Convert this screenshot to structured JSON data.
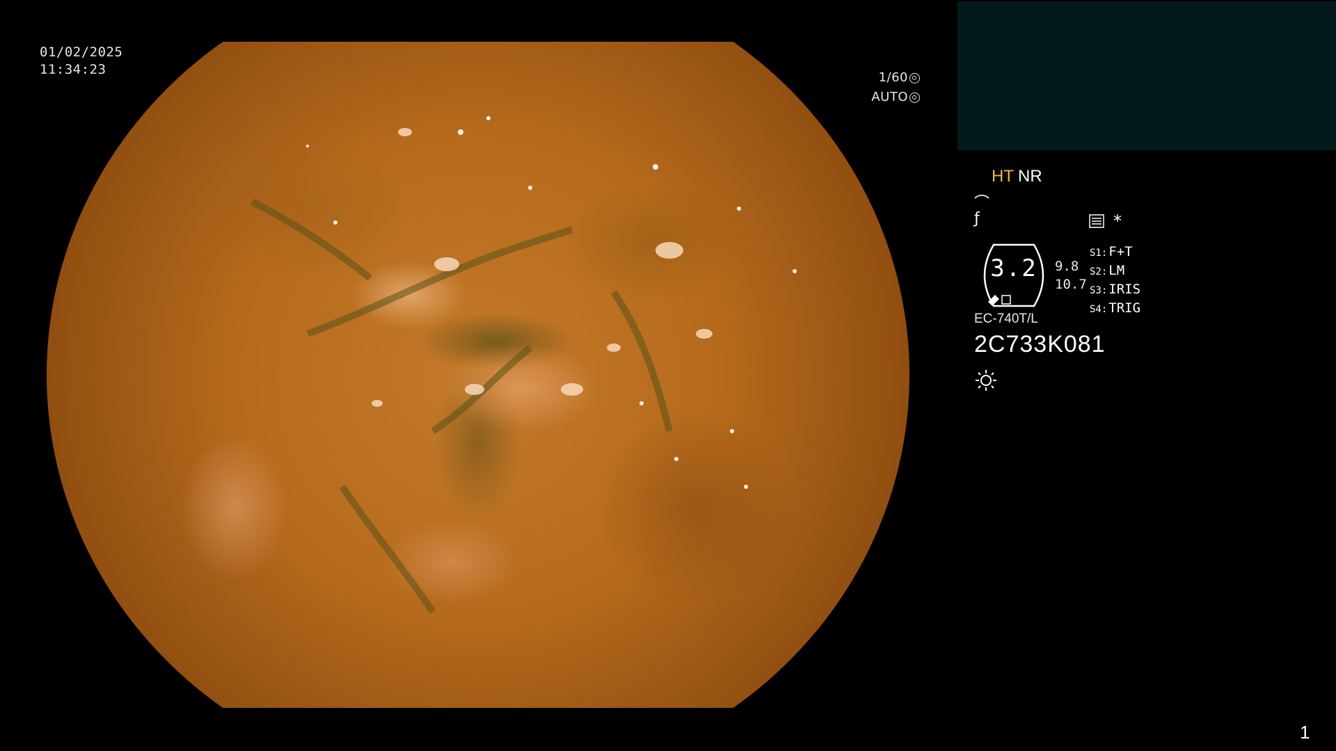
{
  "overlay": {
    "date": "01/02/2025",
    "time": "11:34:23",
    "shutter": "1/60",
    "exposure_mode": "AUTO"
  },
  "processor_panel": {
    "mode_ht": "HT",
    "mode_nr": "NR",
    "zoom_value": "3.2",
    "zoom_side_top": "9.8",
    "zoom_side_bottom": "10.7",
    "switches": [
      {
        "key": "S1:",
        "label": "F+T"
      },
      {
        "key": "S2:",
        "label": "LM"
      },
      {
        "key": "S3:",
        "label": "IRIS"
      },
      {
        "key": "S4:",
        "label": "TRIG"
      }
    ],
    "scope_model": "EC-740T/L",
    "scope_serial": "2C733K081",
    "asterisk": "*"
  },
  "page_number": "1",
  "colors": {
    "accent_ht": "#f0b83c",
    "panel_bg": "#04191a",
    "text": "#e8e8e8"
  },
  "icons": [
    "shutter-icon",
    "auto-iris-icon",
    "curve-icon",
    "enhance-icon",
    "menu-icon",
    "light-icon",
    "pencil-icon"
  ]
}
